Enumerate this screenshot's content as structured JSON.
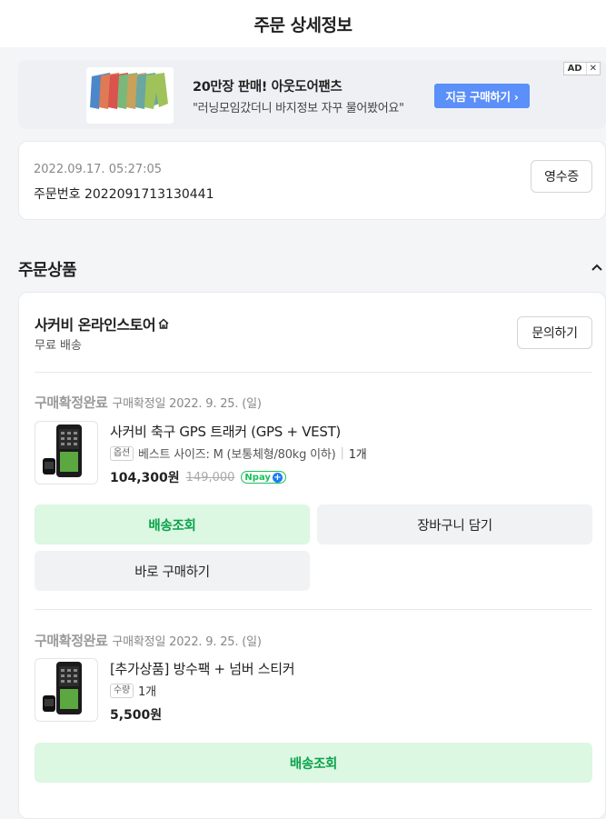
{
  "header": {
    "title": "주문 상세정보"
  },
  "ad": {
    "headline": "20만장 판매! 아웃도어팬츠",
    "subtext": "\"러닝모임갔더니 바지정보 자꾸 물어봤어요\"",
    "cta_label": "지금 구매하기 ›",
    "ad_label": "AD",
    "close_label": "✕"
  },
  "order": {
    "datetime": "2022.09.17. 05:27:05",
    "order_number_label": "주문번호 2022091713130441",
    "receipt_button": "영수증"
  },
  "section": {
    "title": "주문상품"
  },
  "store": {
    "name": "사커비 온라인스토어",
    "shipping": "무료 배송",
    "inquiry_button": "문의하기"
  },
  "items": [
    {
      "status": "구매확정완료",
      "status_date": "구매확정일 2022. 9. 25. (일)",
      "name": "사커비 축구 GPS 트래커 (GPS + VEST)",
      "option_chip": "옵션",
      "option_text": "베스트 사이즈: M (보통체형/80kg 이하)",
      "option_sep": "|",
      "quantity": "1개",
      "price": "104,300원",
      "original_price": "149,000",
      "npay_label": "Npay",
      "npay_plus": "+",
      "buttons": {
        "track": "배송조회",
        "cart": "장바구니 담기",
        "buy_again": "바로 구매하기"
      }
    },
    {
      "status": "구매확정완료",
      "status_date": "구매확정일 2022. 9. 25. (일)",
      "name": "[추가상품] 방수팩 + 넘버 스티커",
      "option_chip": "수량",
      "quantity": "1개",
      "price": "5,500원",
      "buttons": {
        "track": "배송조회"
      }
    }
  ],
  "colors": {
    "accent_green": "#0ba24b",
    "green_button_bg": "#dcf7e2",
    "ad_cta_blue": "#5b8ff9",
    "npay_blue": "#1a7cf0"
  }
}
